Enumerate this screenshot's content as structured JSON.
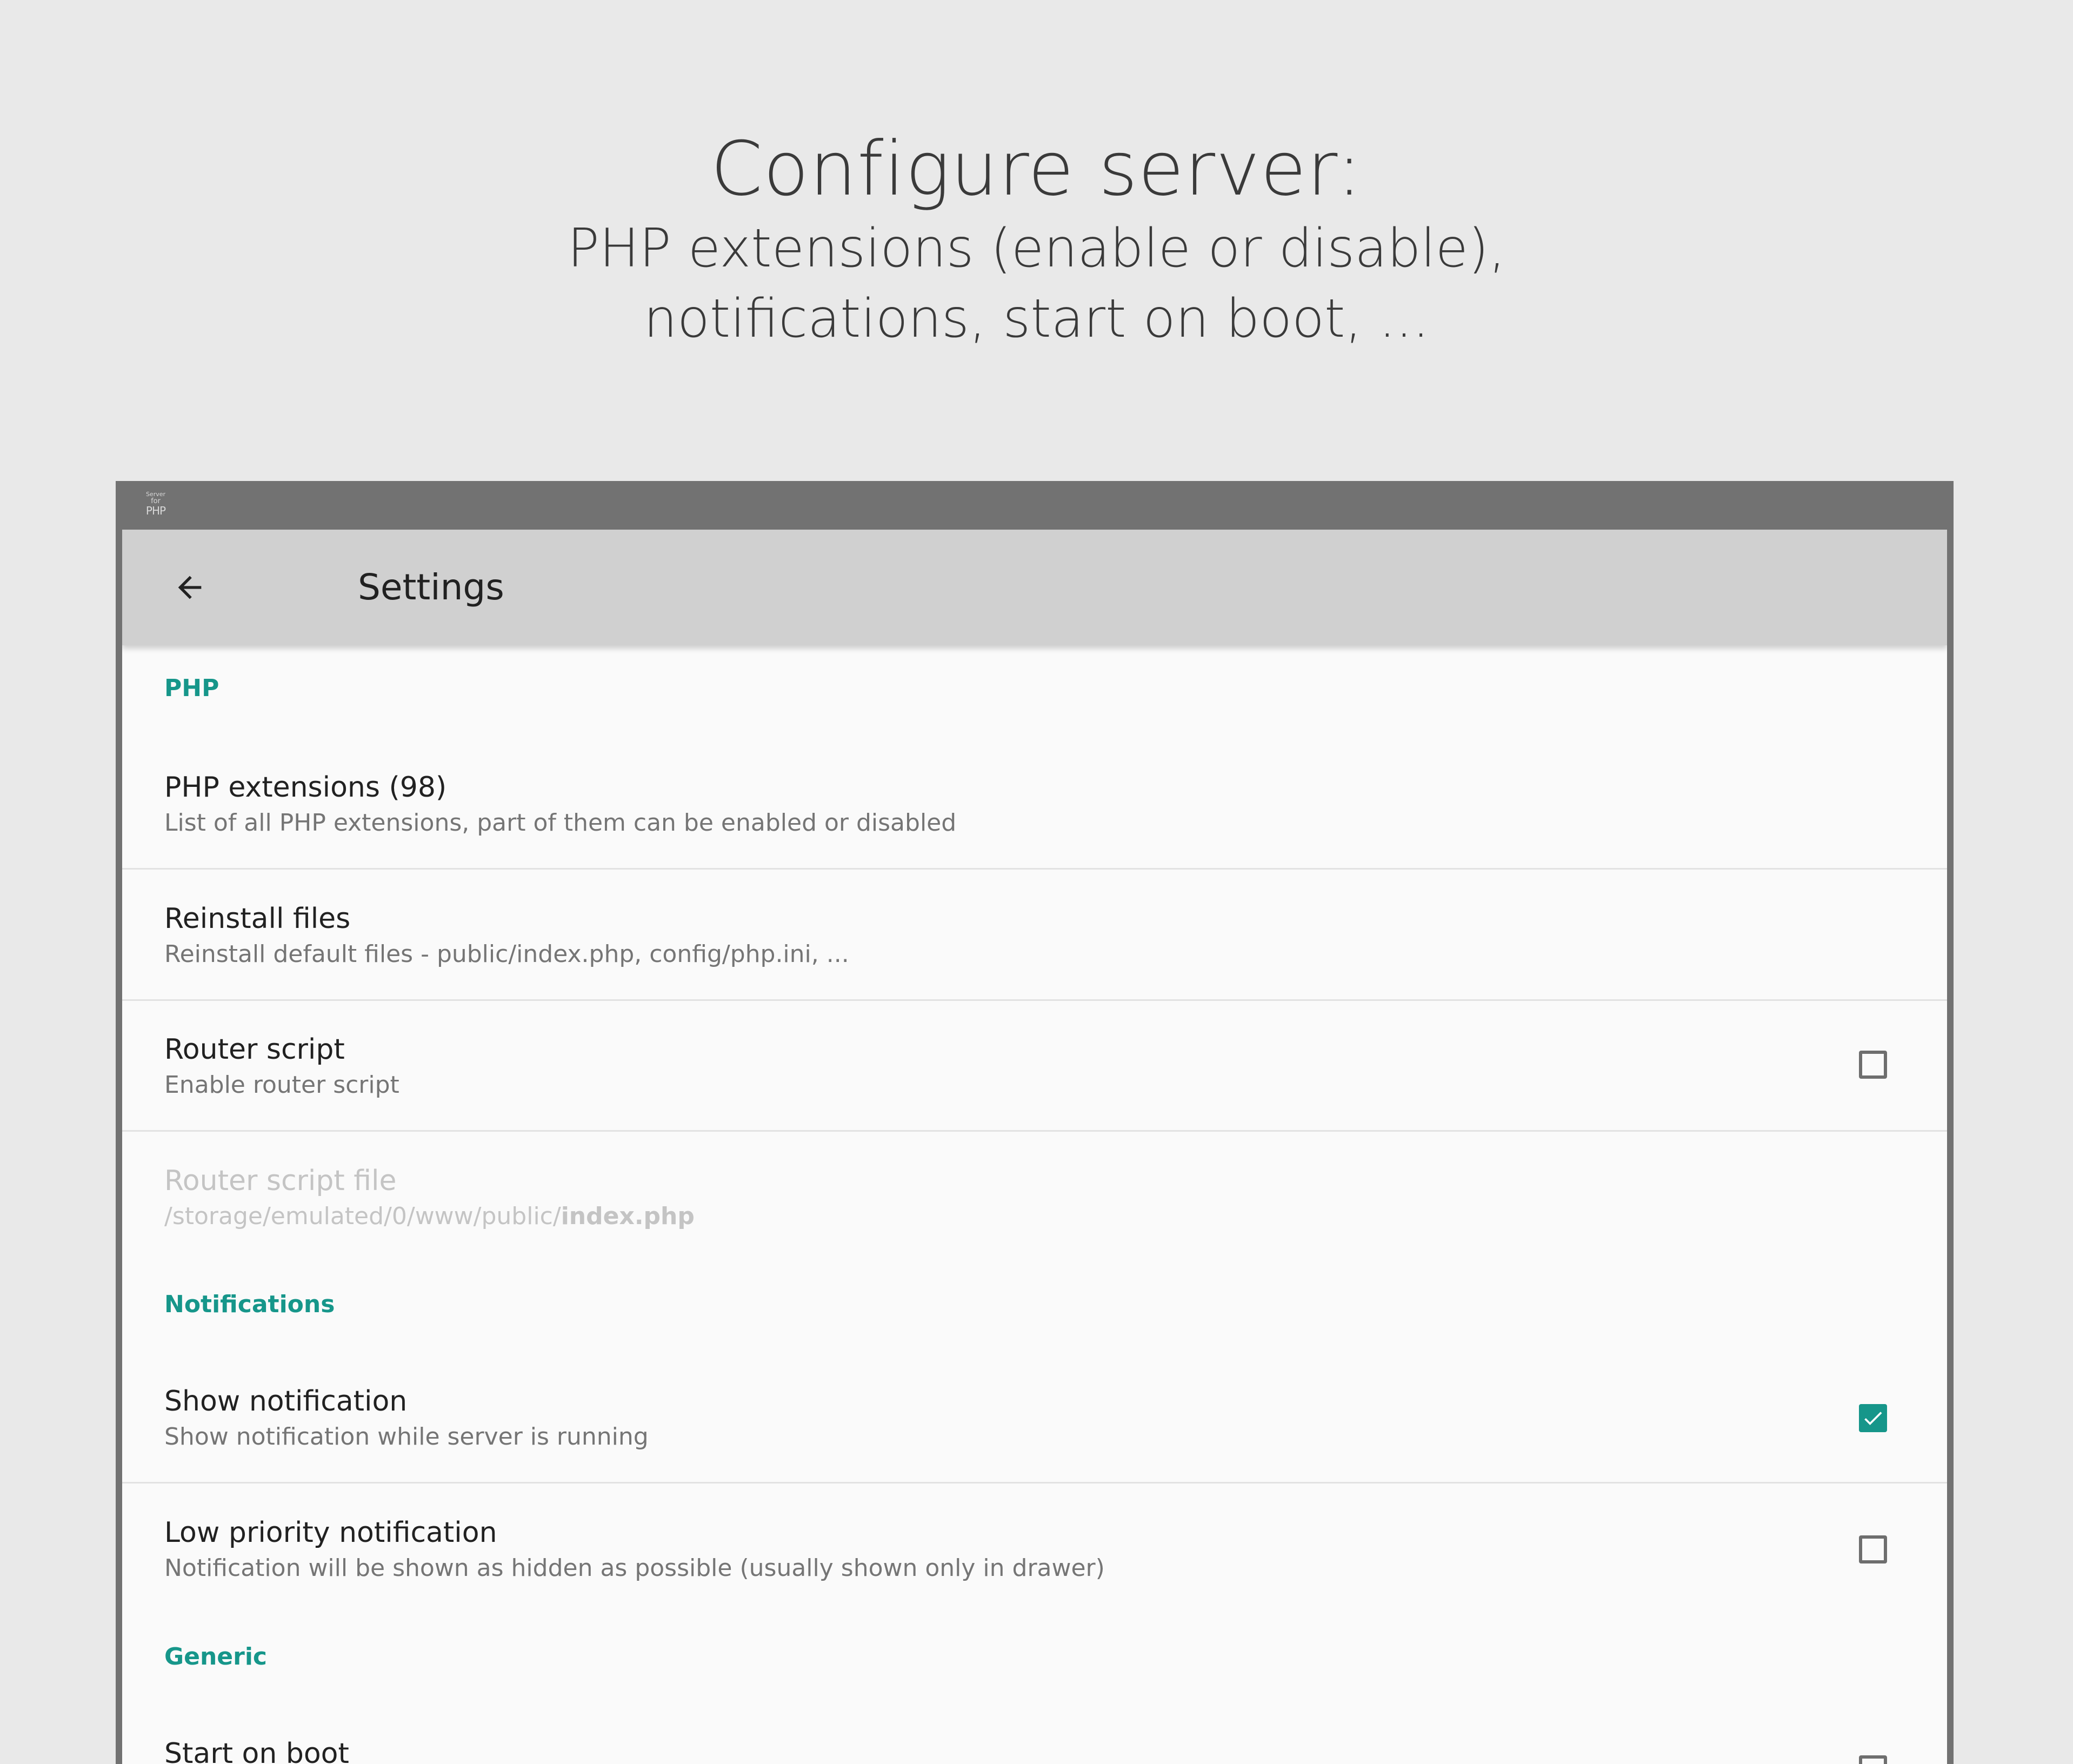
{
  "hero": {
    "title": "Configure server:",
    "subtitle_line1": "PHP extensions (enable or disable),",
    "subtitle_line2": "notifications, start on boot,  ..."
  },
  "statusbar": {
    "app_logo": {
      "line1": "Server",
      "line2": "for",
      "line3": "PHP"
    }
  },
  "toolbar": {
    "back_icon": "arrow-left-icon",
    "title": "Settings"
  },
  "colors": {
    "accent": "#16968a",
    "toolbar_bg": "#d0d0d0",
    "frame": "#727272",
    "background": "#e9e9e9"
  },
  "sections": [
    {
      "category": "PHP",
      "items": [
        {
          "title": "PHP extensions (98)",
          "summary": "List of all PHP extensions, part of them can be enabled or disabled"
        },
        {
          "title": "Reinstall files",
          "summary": "Reinstall default files - public/index.php, config/php.ini, ..."
        },
        {
          "title": "Router script",
          "summary": "Enable router script",
          "checked": false
        },
        {
          "title": "Router script file",
          "summary_prefix": "/storage/emulated/0/www/public/",
          "summary_bold": "index.php",
          "enabled": false
        }
      ]
    },
    {
      "category": "Notifications",
      "items": [
        {
          "title": "Show notification",
          "summary": "Show notification while server is running",
          "checked": true
        },
        {
          "title": "Low priority notification",
          "summary": "Notification will be shown as hidden as possible (usually shown only in drawer)",
          "checked": false
        }
      ]
    },
    {
      "category": "Generic",
      "items": [
        {
          "title": "Start on boot",
          "checked": false
        }
      ]
    }
  ]
}
